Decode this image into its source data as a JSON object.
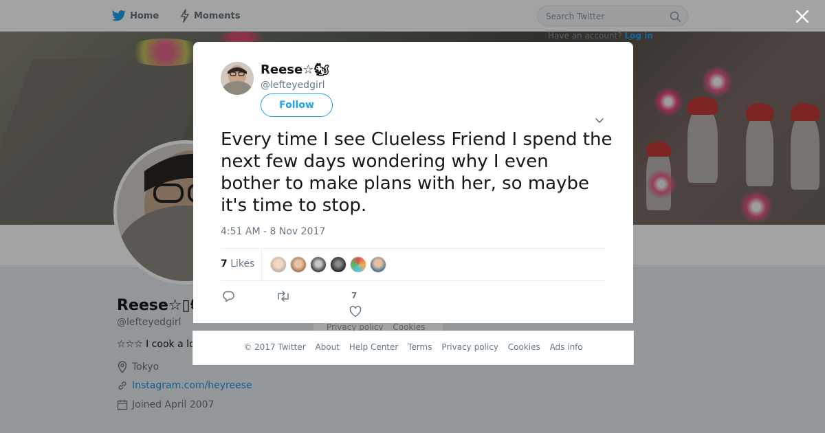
{
  "nav": {
    "home_label": "Home",
    "moments_label": "Moments"
  },
  "search": {
    "placeholder": "Search Twitter"
  },
  "account": {
    "prompt": "Have an account?",
    "login_label": "Log in"
  },
  "profile": {
    "name": "Reese☆▯🐿",
    "handle": "@lefteyedgirl",
    "bio": "☆☆☆ I cook a lot",
    "location": "Tokyo",
    "link": "Instagram.com/heyreese",
    "joined": "Joined April 2007"
  },
  "background_footer": {
    "privacy": "Privacy policy",
    "cookies": "Cookies"
  },
  "tweet": {
    "author_name": "Reese☆🐿",
    "author_handle": "@lefteyedgirl",
    "follow_label": "Follow",
    "text": "Every time I see Clueless Friend I spend the next few days wondering why I even bother to make plans with her, so maybe it's time to stop.",
    "timestamp": "4:51 AM - 8 Nov 2017",
    "likes_number": "7",
    "likes_word": "Likes",
    "like_action_count": "7"
  },
  "footer": {
    "copyright": "© 2017 Twitter",
    "links": [
      "About",
      "Help Center",
      "Terms",
      "Privacy policy",
      "Cookies",
      "Ads info"
    ]
  },
  "colors": {
    "accent": "#1da1f2",
    "link": "#1b95e0",
    "muted_text": "#657786",
    "overlay": "rgba(0,0,0,0.36)"
  },
  "icons": [
    "twitter-bird-icon",
    "lightning-icon",
    "search-icon",
    "close-icon",
    "chevron-down-icon",
    "reply-icon",
    "retweet-icon",
    "heart-icon",
    "location-pin-icon",
    "link-icon",
    "calendar-icon"
  ]
}
